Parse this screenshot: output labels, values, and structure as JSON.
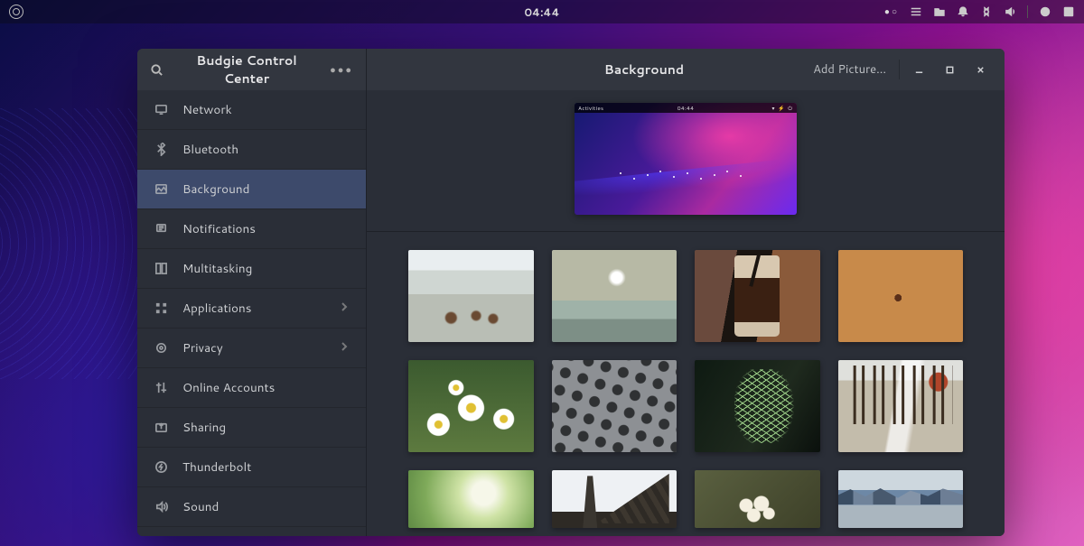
{
  "panel": {
    "clock": "04:44"
  },
  "window": {
    "title": "Budgie Control Center",
    "page_title": "Background",
    "add_picture": "Add Picture...",
    "preview": {
      "activities": "Activities",
      "clock": "04:44"
    }
  },
  "sidebar": {
    "items": [
      {
        "label": "Network",
        "icon": "display-icon",
        "active": false,
        "chevron": false
      },
      {
        "label": "Bluetooth",
        "icon": "bluetooth-icon",
        "active": false,
        "chevron": false
      },
      {
        "label": "Background",
        "icon": "background-icon",
        "active": true,
        "chevron": false
      },
      {
        "label": "Notifications",
        "icon": "bell-icon",
        "active": false,
        "chevron": false
      },
      {
        "label": "Multitasking",
        "icon": "multitask-icon",
        "active": false,
        "chevron": false
      },
      {
        "label": "Applications",
        "icon": "grid-icon",
        "active": false,
        "chevron": true
      },
      {
        "label": "Privacy",
        "icon": "privacy-icon",
        "active": false,
        "chevron": true
      },
      {
        "label": "Online Accounts",
        "icon": "accounts-icon",
        "active": false,
        "chevron": false
      },
      {
        "label": "Sharing",
        "icon": "share-icon",
        "active": false,
        "chevron": false
      },
      {
        "label": "Thunderbolt",
        "icon": "thunderbolt-icon",
        "active": false,
        "chevron": false
      },
      {
        "label": "Sound",
        "icon": "sound-icon",
        "active": false,
        "chevron": false
      }
    ]
  },
  "wallpapers": [
    {
      "name": "beach-driftwood",
      "css": "wp-beach-driftwood"
    },
    {
      "name": "ocean-sky",
      "css": "wp-ocean-sky"
    },
    {
      "name": "iced-coffee",
      "css": "wp-iced-coffee"
    },
    {
      "name": "tree-rings",
      "css": "wp-tree-rings"
    },
    {
      "name": "daisies",
      "css": "wp-daisies"
    },
    {
      "name": "metal-grid",
      "css": "wp-metal-grid"
    },
    {
      "name": "fern",
      "css": "wp-fern"
    },
    {
      "name": "forest-rays",
      "css": "wp-forest-rays"
    },
    {
      "name": "blur-green",
      "css": "wp-blur-green"
    },
    {
      "name": "windmill",
      "css": "wp-windmill"
    },
    {
      "name": "blossom",
      "css": "wp-blossom"
    },
    {
      "name": "mountain-lake",
      "css": "wp-mountain-lake"
    }
  ]
}
